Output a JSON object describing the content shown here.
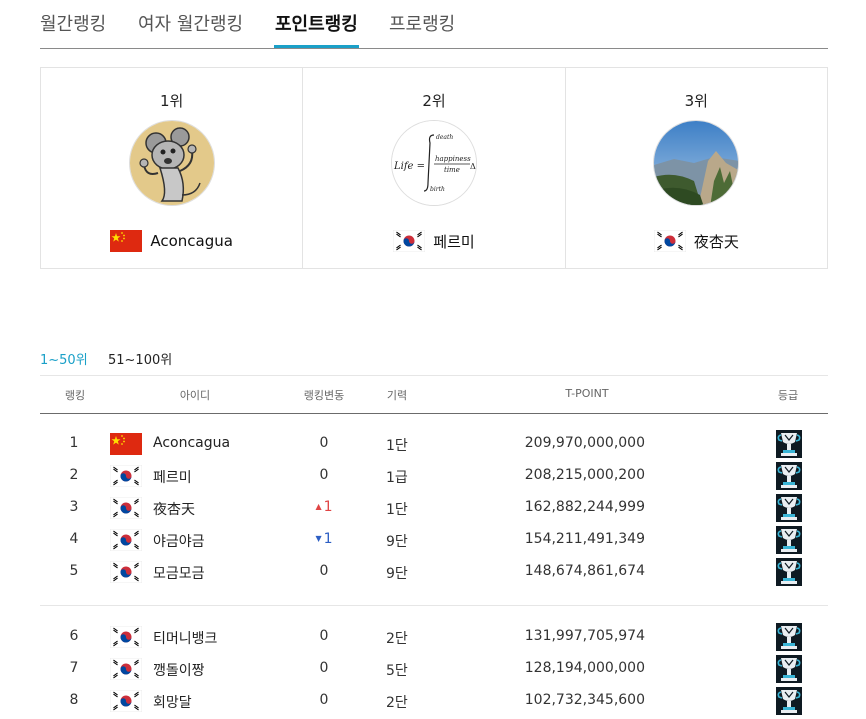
{
  "tabs": [
    {
      "label": "월간랭킹",
      "active": false
    },
    {
      "label": "여자 월간랭킹",
      "active": false
    },
    {
      "label": "포인트랭킹",
      "active": true
    },
    {
      "label": "프로랭킹",
      "active": false
    }
  ],
  "top3": [
    {
      "rank": "1위",
      "name": "Aconcagua",
      "flag": "china-flag",
      "avatar": "mouse-cartoon-avatar"
    },
    {
      "rank": "2위",
      "name": "페르미",
      "flag": "korea-flag",
      "avatar": "life-formula-avatar"
    },
    {
      "rank": "3위",
      "name": "夜杏天",
      "flag": "korea-flag",
      "avatar": "mountain-landscape-avatar"
    }
  ],
  "life_formula": {
    "lhs": "Life =",
    "upper": "death",
    "numerator": "happiness",
    "denominator": "time",
    "lower": "birth",
    "delta": "Δ"
  },
  "range_tabs": [
    {
      "label": "1~50위",
      "active": true
    },
    {
      "label": "51~100위",
      "active": false
    }
  ],
  "table": {
    "headers": {
      "rank": "랭킹",
      "id": "아이디",
      "change": "랭킹변동",
      "level": "기력",
      "point": "T-POINT",
      "grade": "등급"
    },
    "rows": [
      {
        "rank": "1",
        "flag": "china-flag",
        "id": "Aconcagua",
        "change": "0",
        "change_dir": "none",
        "level": "1단",
        "point": "209,970,000,000",
        "grade_icon": "trophy-icon"
      },
      {
        "rank": "2",
        "flag": "korea-flag",
        "id": "페르미",
        "change": "0",
        "change_dir": "none",
        "level": "1급",
        "point": "208,215,000,200",
        "grade_icon": "trophy-icon"
      },
      {
        "rank": "3",
        "flag": "korea-flag",
        "id": "夜杏天",
        "change": "1",
        "change_dir": "up",
        "level": "1단",
        "point": "162,882,244,999",
        "grade_icon": "trophy-icon"
      },
      {
        "rank": "4",
        "flag": "korea-flag",
        "id": "야금야금",
        "change": "1",
        "change_dir": "down",
        "level": "9단",
        "point": "154,211,491,349",
        "grade_icon": "trophy-icon"
      },
      {
        "rank": "5",
        "flag": "korea-flag",
        "id": "모금모금",
        "change": "0",
        "change_dir": "none",
        "level": "9단",
        "point": "148,674,861,674",
        "grade_icon": "trophy-icon"
      },
      {
        "rank": "6",
        "flag": "korea-flag",
        "id": "티머니뱅크",
        "change": "0",
        "change_dir": "none",
        "level": "2단",
        "point": "131,997,705,974",
        "grade_icon": "trophy-icon"
      },
      {
        "rank": "7",
        "flag": "korea-flag",
        "id": "깽돌이짱",
        "change": "0",
        "change_dir": "none",
        "level": "5단",
        "point": "128,194,000,000",
        "grade_icon": "trophy-icon"
      },
      {
        "rank": "8",
        "flag": "korea-flag",
        "id": "회망달",
        "change": "0",
        "change_dir": "none",
        "level": "2단",
        "point": "102,732,345,600",
        "grade_icon": "trophy-icon"
      }
    ]
  },
  "colors": {
    "accent": "#1aa0c8",
    "rank_up": "#e04545",
    "rank_down": "#2d5fc4"
  }
}
